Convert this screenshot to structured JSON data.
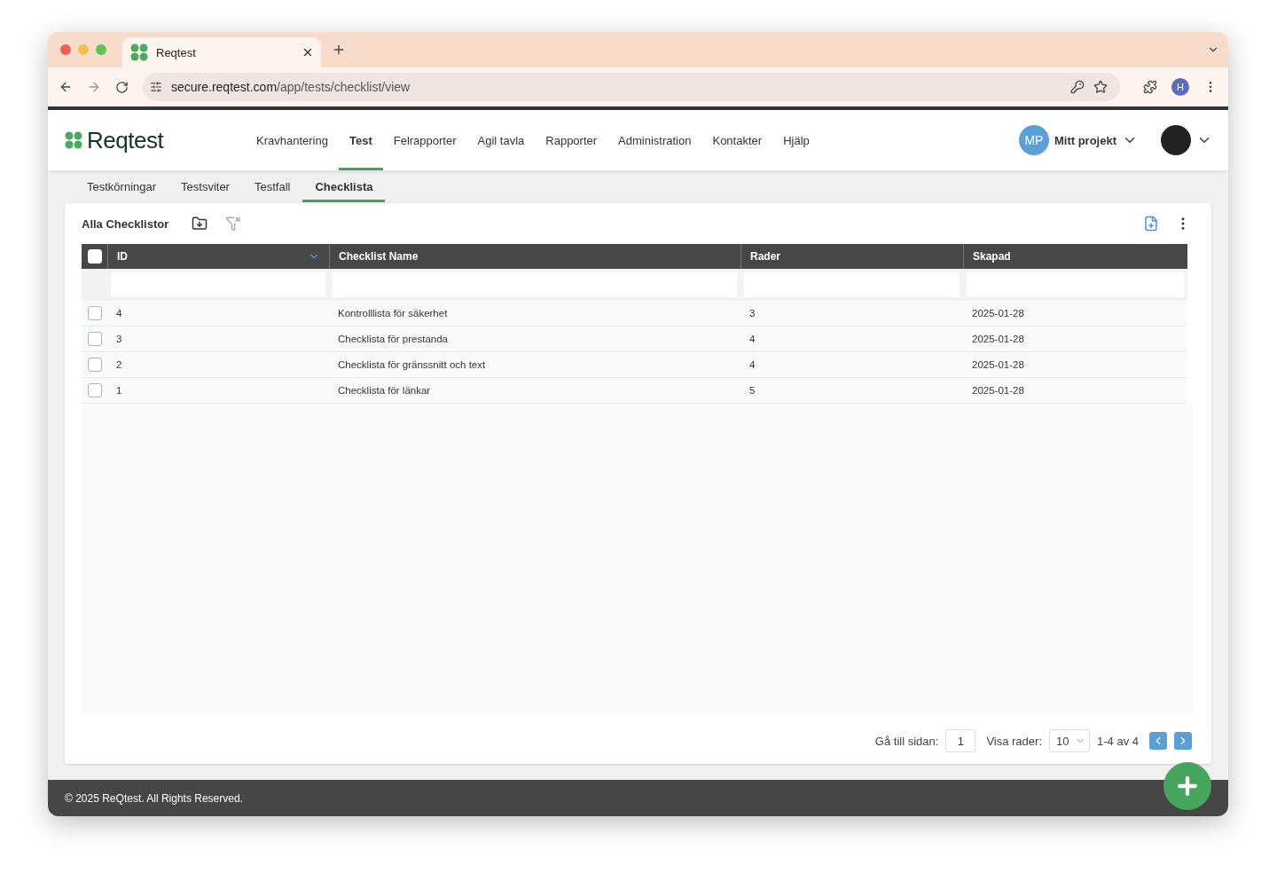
{
  "browser": {
    "tab_title": "Reqtest",
    "url_host": "secure.reqtest.com",
    "url_path": "/app/tests/checklist/view",
    "profile_initial": "H"
  },
  "app": {
    "logo": "Reqtest",
    "nav": [
      {
        "label": "Kravhantering",
        "selected": false
      },
      {
        "label": "Test",
        "selected": true
      },
      {
        "label": "Felrapporter",
        "selected": false
      },
      {
        "label": "Agil tavla",
        "selected": false
      },
      {
        "label": "Rapporter",
        "selected": false
      },
      {
        "label": "Administration",
        "selected": false
      },
      {
        "label": "Kontakter",
        "selected": false
      },
      {
        "label": "Hjälp",
        "selected": false
      }
    ],
    "project": {
      "initials": "MP",
      "name": "Mitt projekt"
    }
  },
  "subtabs": [
    {
      "label": "Testkörningar",
      "selected": false
    },
    {
      "label": "Testsviter",
      "selected": false
    },
    {
      "label": "Testfall",
      "selected": false
    },
    {
      "label": "Checklista",
      "selected": true
    }
  ],
  "panel": {
    "title": "Alla Checklistor"
  },
  "table": {
    "select_all": false,
    "columns": [
      "ID",
      "Checklist Name",
      "Rader",
      "Skapad"
    ],
    "rows": [
      {
        "checked": false,
        "cells": [
          "4",
          "Kontrolllista för säkerhet",
          "3",
          "2025-01-28"
        ]
      },
      {
        "checked": false,
        "cells": [
          "3",
          "Checklista för prestanda",
          "4",
          "2025-01-28"
        ]
      },
      {
        "checked": false,
        "cells": [
          "2",
          "Checklista för gränssnitt och text",
          "4",
          "2025-01-28"
        ]
      },
      {
        "checked": false,
        "cells": [
          "1",
          "Checklista för länkar",
          "5",
          "2025-01-28"
        ]
      }
    ]
  },
  "pagination": {
    "goto_label": "Gå till sidan:",
    "goto_value": "1",
    "rows_label": "Visa rader:",
    "rows_value": "10",
    "range": "1-4 av 4"
  },
  "footer": "© 2025 ReQtest. All Rights Reserved."
}
